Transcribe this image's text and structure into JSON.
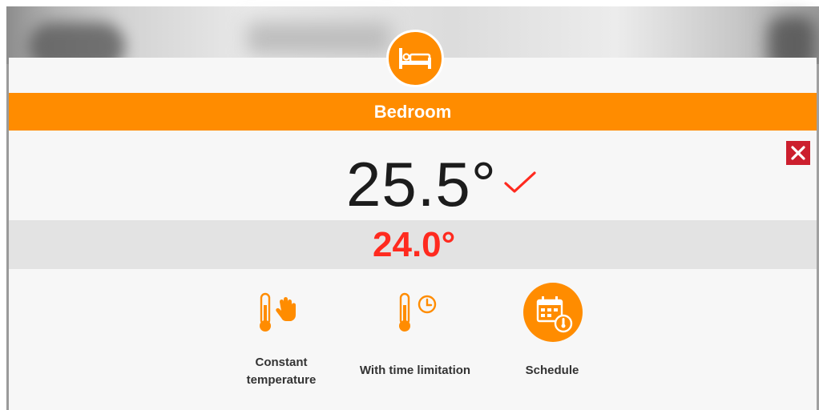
{
  "room": {
    "name": "Bedroom",
    "icon": "bed-icon"
  },
  "temperature": {
    "current": "25.5°",
    "set": "24.0°",
    "status_icon": "check-icon"
  },
  "close": {
    "icon": "close-icon"
  },
  "modes": [
    {
      "label": "Constant temperature",
      "icon": "thermometer-hand-icon"
    },
    {
      "label": "With time limitation",
      "icon": "thermometer-clock-icon"
    },
    {
      "label": "Schedule",
      "icon": "schedule-calendar-icon"
    }
  ],
  "colors": {
    "accent": "#ff8c00",
    "set_temp": "#ff2a1f",
    "close": "#cc1f2e",
    "band": "#e3e3e3"
  }
}
